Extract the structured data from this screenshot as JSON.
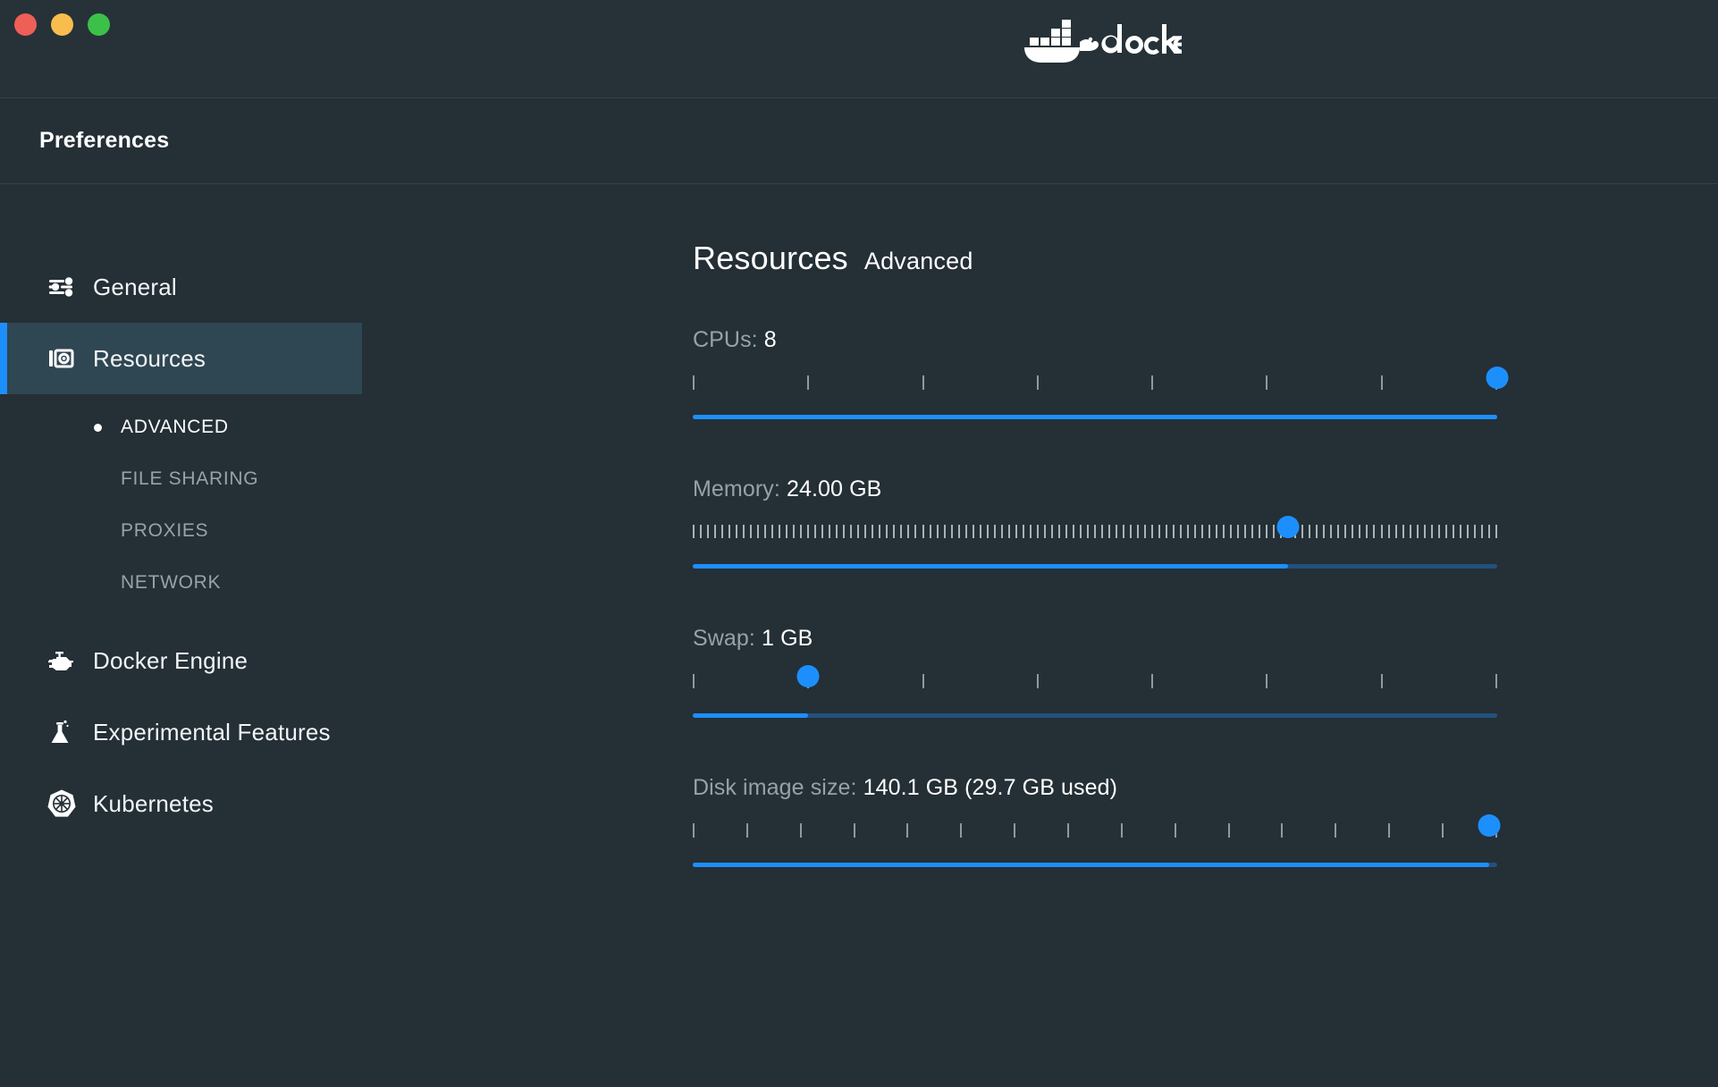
{
  "window": {
    "traffic_lights": [
      {
        "name": "close",
        "color": "#ee5f56"
      },
      {
        "name": "minimize",
        "color": "#f9bd4e"
      },
      {
        "name": "maximize",
        "color": "#3bc14a"
      }
    ],
    "brand": "docker",
    "header_title": "Preferences"
  },
  "sidebar": {
    "items": [
      {
        "label": "General",
        "icon": "sliders-icon",
        "active": false
      },
      {
        "label": "Resources",
        "icon": "resources-icon",
        "active": true
      },
      {
        "label": "Docker Engine",
        "icon": "engine-icon",
        "active": false
      },
      {
        "label": "Experimental Features",
        "icon": "flask-icon",
        "active": false
      },
      {
        "label": "Kubernetes",
        "icon": "helm-wheel-icon",
        "active": false
      }
    ],
    "subitems": [
      {
        "label": "ADVANCED",
        "active": true
      },
      {
        "label": "FILE SHARING",
        "active": false
      },
      {
        "label": "PROXIES",
        "active": false
      },
      {
        "label": "NETWORK",
        "active": false
      }
    ]
  },
  "main": {
    "title": "Resources",
    "subtitle": "Advanced",
    "sliders": [
      {
        "name": "cpus",
        "label": "CPUs:",
        "value": "8",
        "ticks": 8,
        "dense": false,
        "percent": 100
      },
      {
        "name": "memory",
        "label": "Memory:",
        "value": "24.00 GB",
        "ticks": 113,
        "dense": true,
        "percent": 74
      },
      {
        "name": "swap",
        "label": "Swap:",
        "value": "1 GB",
        "ticks": 8,
        "dense": false,
        "percent": 14.3
      },
      {
        "name": "disk-image-size",
        "label": "Disk image size:",
        "value": "140.1 GB (29.7 GB used)",
        "ticks": 16,
        "dense": false,
        "percent": 99
      }
    ]
  },
  "colors": {
    "accent": "#1d8ffd",
    "track_unfilled": "#23507d",
    "background": "#242f36",
    "titlebar": "#263238",
    "active_item": "#2f4653",
    "label_muted": "#97a2a8"
  }
}
